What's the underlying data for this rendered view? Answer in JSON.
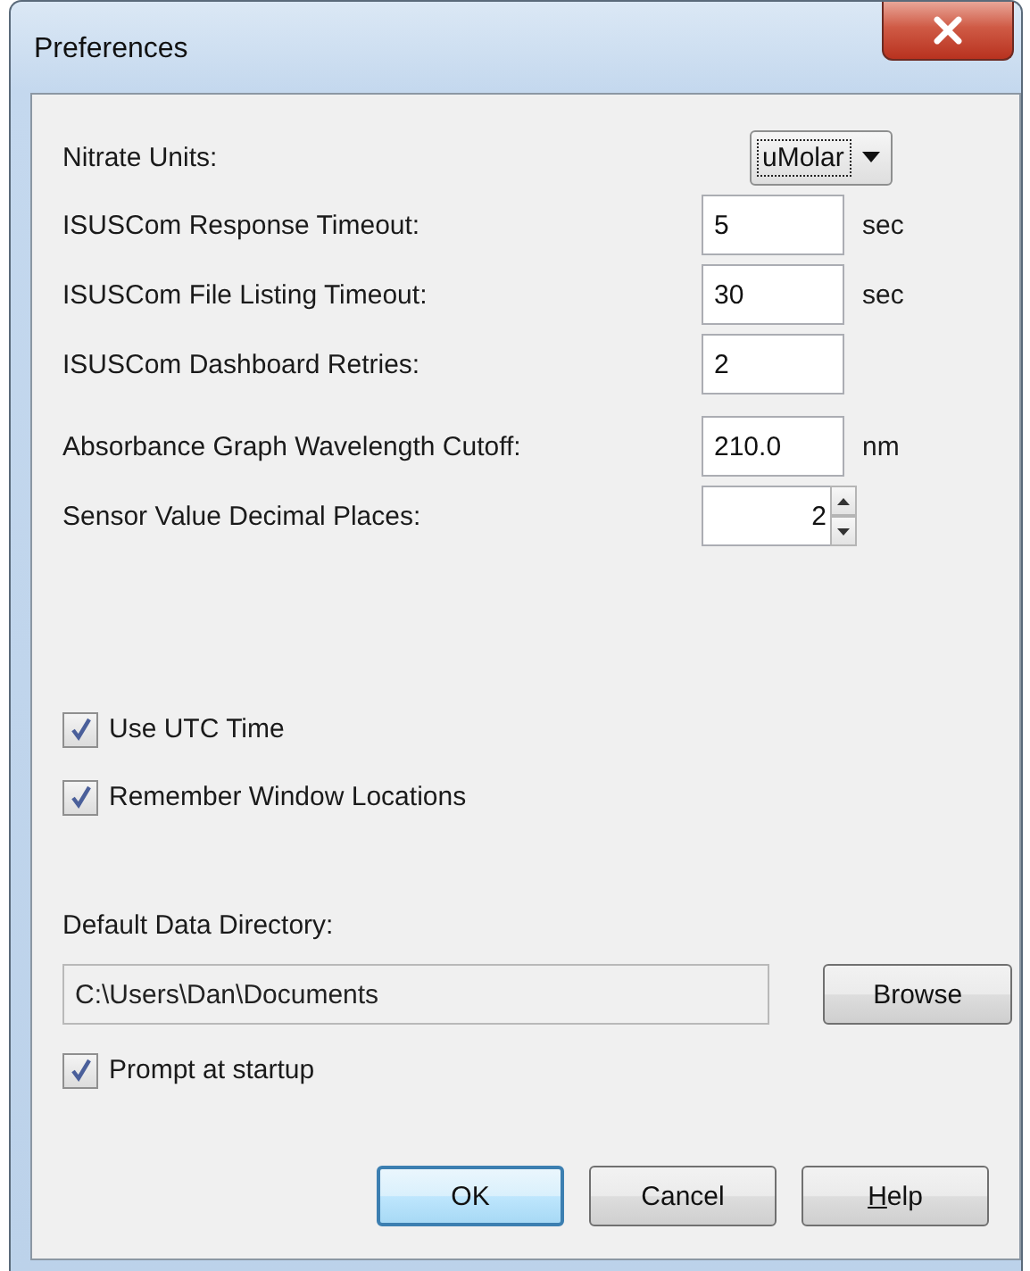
{
  "window": {
    "title": "Preferences"
  },
  "setting_groups": [
    [
      {
        "kind": "dropdown",
        "label": "Nitrate Units:",
        "value": "uMolar",
        "focused": true
      },
      {
        "kind": "text",
        "label": "ISUSCom Response Timeout:",
        "value": "5",
        "unit": "sec"
      },
      {
        "kind": "text",
        "label": "ISUSCom File Listing Timeout:",
        "value": "30",
        "unit": "sec"
      },
      {
        "kind": "text",
        "label": "ISUSCom Dashboard Retries:",
        "value": "2"
      }
    ],
    [
      {
        "kind": "text",
        "label": "Absorbance Graph Wavelength Cutoff:",
        "value": "210.0",
        "unit": "nm"
      },
      {
        "kind": "spinner",
        "label": "Sensor Value Decimal Places:",
        "value": "2"
      }
    ]
  ],
  "checkboxes": [
    {
      "label": "Use UTC Time",
      "checked": true
    },
    {
      "label": "Remember Window Locations",
      "checked": true
    }
  ],
  "directory": {
    "label": "Default Data Directory:",
    "value": "C:\\Users\\Dan\\Documents",
    "button": "Browse",
    "prompt": {
      "label": "Prompt at startup",
      "checked": true
    }
  },
  "buttons": [
    {
      "label": "OK",
      "default": true,
      "underline_first": false
    },
    {
      "label": "Cancel",
      "default": false,
      "underline_first": false
    },
    {
      "label": "Help",
      "default": false,
      "underline_first": true
    }
  ]
}
